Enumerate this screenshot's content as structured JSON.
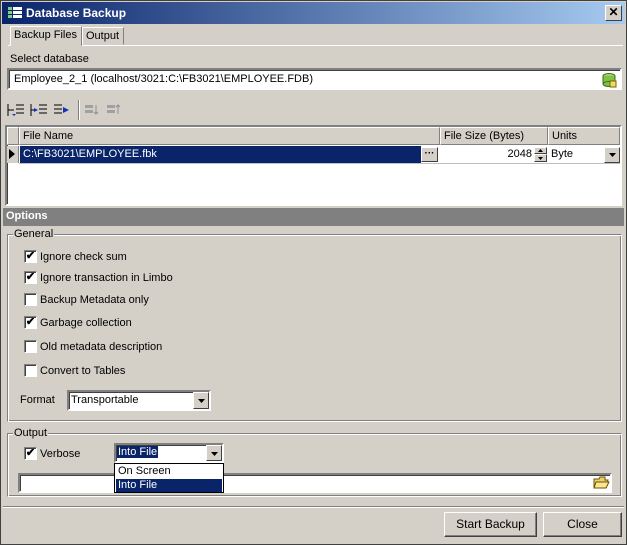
{
  "window": {
    "title": "Database Backup",
    "close_glyph": "✕"
  },
  "tabs": [
    {
      "label": "Backup Files",
      "active": true
    },
    {
      "label": "Output",
      "active": false
    }
  ],
  "select_database": {
    "label": "Select database",
    "value": "Employee_2_1 (localhost/3021:C:\\FB3021\\EMPLOYEE.FDB)"
  },
  "toolbar": {
    "icons": [
      "add-file-icon",
      "insert-file-icon",
      "remove-file-icon",
      "move-down-icon",
      "move-up-icon"
    ]
  },
  "grid": {
    "columns": [
      "File Name",
      "File Size (Bytes)",
      "Units"
    ],
    "rows": [
      {
        "file_name": "C:\\FB3021\\EMPLOYEE.fbk",
        "size": "2048",
        "units": "Byte"
      }
    ]
  },
  "options": {
    "header": "Options",
    "general": {
      "title": "General",
      "checkboxes": [
        {
          "label": "Ignore check sum",
          "checked": true
        },
        {
          "label": "Ignore transaction in Limbo",
          "checked": true
        },
        {
          "label": "Backup Metadata only",
          "checked": false
        },
        {
          "label": "Garbage collection",
          "checked": true
        },
        {
          "label": "Old metadata description",
          "checked": false
        },
        {
          "label": "Convert to Tables",
          "checked": false
        }
      ],
      "format_label": "Format",
      "format_value": "Transportable"
    },
    "output": {
      "title": "Output",
      "verbose_label": "Verbose",
      "verbose_checked": true,
      "verbose_value": "Into File",
      "dropdown_options": [
        "On Screen",
        "Into File"
      ],
      "file_path": ""
    }
  },
  "buttons": {
    "start": "Start Backup",
    "close": "Close"
  },
  "colors": {
    "title_start": "#0a246a",
    "title_end": "#a6caf0",
    "selection": "#0a246a",
    "face": "#d4d0c8"
  }
}
